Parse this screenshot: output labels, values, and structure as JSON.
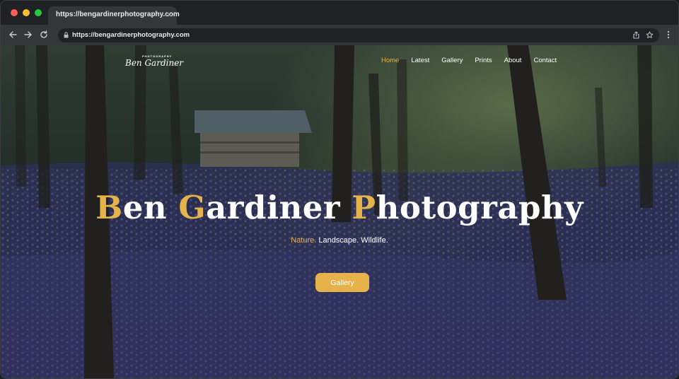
{
  "browser": {
    "tab_title": "https://bengardinerphotography.com",
    "tab_close": "×",
    "url": "https://bengardinerphotography.com",
    "traffic_lights": [
      "#ff5f57",
      "#febc2e",
      "#28c840"
    ]
  },
  "site": {
    "logo": {
      "top_text": "PHOTOGRAPHY",
      "script_text": "Ben Gardiner"
    },
    "nav": [
      {
        "label": "Home",
        "active": true
      },
      {
        "label": "Latest",
        "active": false
      },
      {
        "label": "Gallery",
        "active": false
      },
      {
        "label": "Prints",
        "active": false
      },
      {
        "label": "About",
        "active": false
      },
      {
        "label": "Contact",
        "active": false
      }
    ],
    "hero": {
      "title_parts": [
        {
          "cap": "B",
          "rest": "en "
        },
        {
          "cap": "G",
          "rest": "ardiner "
        },
        {
          "cap": "P",
          "rest": "hotography"
        }
      ],
      "subtitle_accent": "Nature.",
      "subtitle_rest": " Landscape. Wildlife.",
      "button_label": "Gallery"
    },
    "colors": {
      "accent": "#e6b24a",
      "text": "#ffffff"
    },
    "icons": {
      "back": "arrow-left-icon",
      "forward": "arrow-right-icon",
      "reload": "reload-icon",
      "lock": "lock-icon",
      "share": "share-icon",
      "bookmark": "star-icon",
      "menu": "kebab-menu-icon"
    }
  }
}
